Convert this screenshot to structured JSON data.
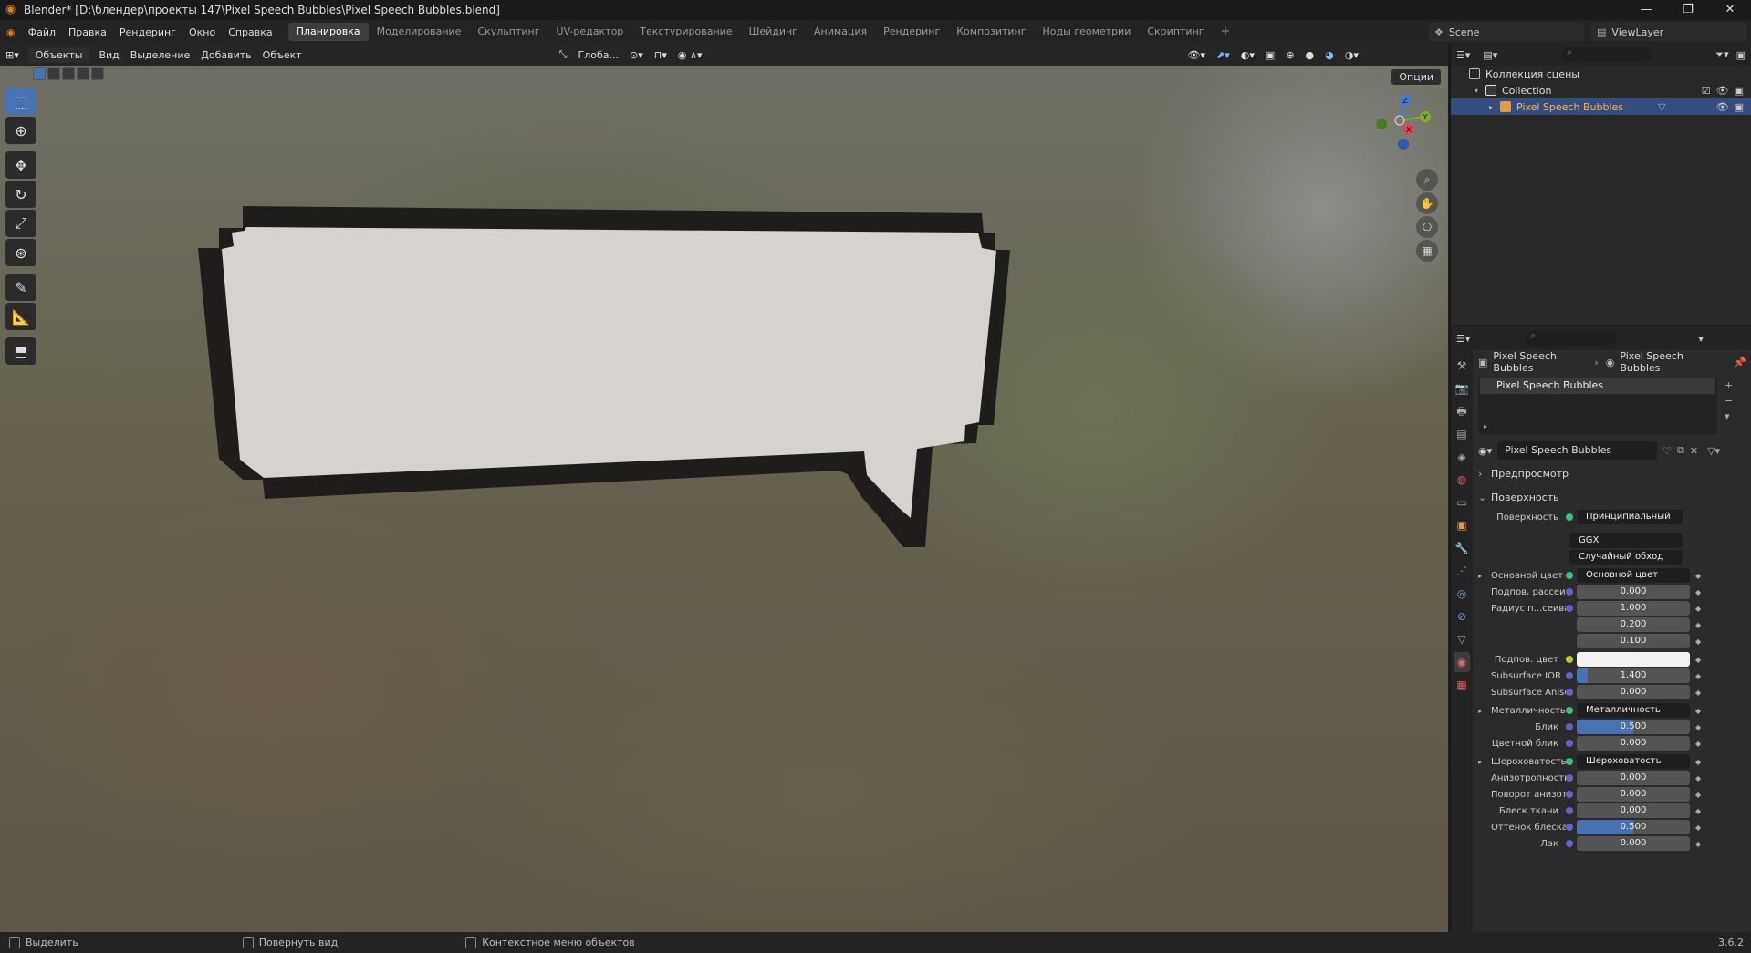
{
  "window": {
    "title": "Blender* [D:\\блендер\\проекты 147\\Pixel Speech Bubbles\\Pixel Speech Bubbles.blend]",
    "min": "—",
    "max": "❐",
    "close": "✕"
  },
  "menu": [
    "Файл",
    "Правка",
    "Рендеринг",
    "Окно",
    "Справка"
  ],
  "workspaces": [
    "Планировка",
    "Моделирование",
    "Скульптинг",
    "UV-редактор",
    "Текстурирование",
    "Шейдинг",
    "Анимация",
    "Рендеринг",
    "Композитинг",
    "Ноды геометрии",
    "Скриптинг"
  ],
  "workspace_plus": "+",
  "scene": {
    "name": "Scene",
    "view_layer": "ViewLayer"
  },
  "viewport": {
    "mode": "Объекты",
    "menu": [
      "Вид",
      "Выделение",
      "Добавить",
      "Объект"
    ],
    "transform_orientation": "Глоба...",
    "options": "Опции",
    "gizmo_axes": {
      "x": "X",
      "y": "Y",
      "z": "Z"
    }
  },
  "outliner": {
    "scene_collection": "Коллекция сцены",
    "collection": "Collection",
    "object": "Pixel Speech Bubbles"
  },
  "properties": {
    "breadcrumb_object": "Pixel Speech Bubbles",
    "breadcrumb_material": "Pixel Speech Bubbles",
    "slot": "Pixel Speech Bubbles",
    "material": "Pixel Speech Bubbles",
    "sections": {
      "preview": "Предпросмотр",
      "surface": "Поверхность"
    },
    "surface_label": "Поверхность",
    "surface_value": "Принципиальный BSDF",
    "distribution": "GGX",
    "subsurface_method": "Случайный обход",
    "rows": [
      {
        "label": "Основной цвет",
        "value": "Основной цвет",
        "kind": "link",
        "expand": "▸"
      },
      {
        "label": "Подпов. рассеива...",
        "value": "0.000",
        "kind": "num"
      },
      {
        "label": "Радиус п...сеивания",
        "value": "1.000",
        "kind": "num"
      },
      {
        "label": "",
        "value": "0.200",
        "kind": "num"
      },
      {
        "label": "",
        "value": "0.100",
        "kind": "num"
      },
      {
        "label": "Подпов. цвет",
        "value": "",
        "kind": "color"
      },
      {
        "label": "Subsurface IOR",
        "value": "1.400",
        "kind": "blue",
        "fill": 0.1
      },
      {
        "label": "Subsurface Anisotr...",
        "value": "0.000",
        "kind": "num"
      },
      {
        "label": "Металличность",
        "value": "Металличность",
        "kind": "link",
        "expand": "▸"
      },
      {
        "label": "Блик",
        "value": "0.500",
        "kind": "blue",
        "fill": 0.5
      },
      {
        "label": "Цветной блик",
        "value": "0.000",
        "kind": "num"
      },
      {
        "label": "Шероховатость",
        "value": "Шероховатость",
        "kind": "link",
        "expand": "▸"
      },
      {
        "label": "Анизотропность",
        "value": "0.000",
        "kind": "num"
      },
      {
        "label": "Поворот анизотро...",
        "value": "0.000",
        "kind": "num"
      },
      {
        "label": "Блеск ткани",
        "value": "0.000",
        "kind": "num"
      },
      {
        "label": "Оттенок блеска тк...",
        "value": "0.500",
        "kind": "blue",
        "fill": 0.5
      },
      {
        "label": "Лак",
        "value": "0.000",
        "kind": "num"
      }
    ]
  },
  "status": {
    "select": "Выделить",
    "rotate": "Повернуть вид",
    "context": "Контекстное меню объектов",
    "version": "3.6.2"
  },
  "colors": {
    "accent": "#4772b3",
    "selected_row": "#334d80",
    "bubble_fill": "#d6d3cf",
    "bubble_outline": "#1f1d1b"
  }
}
